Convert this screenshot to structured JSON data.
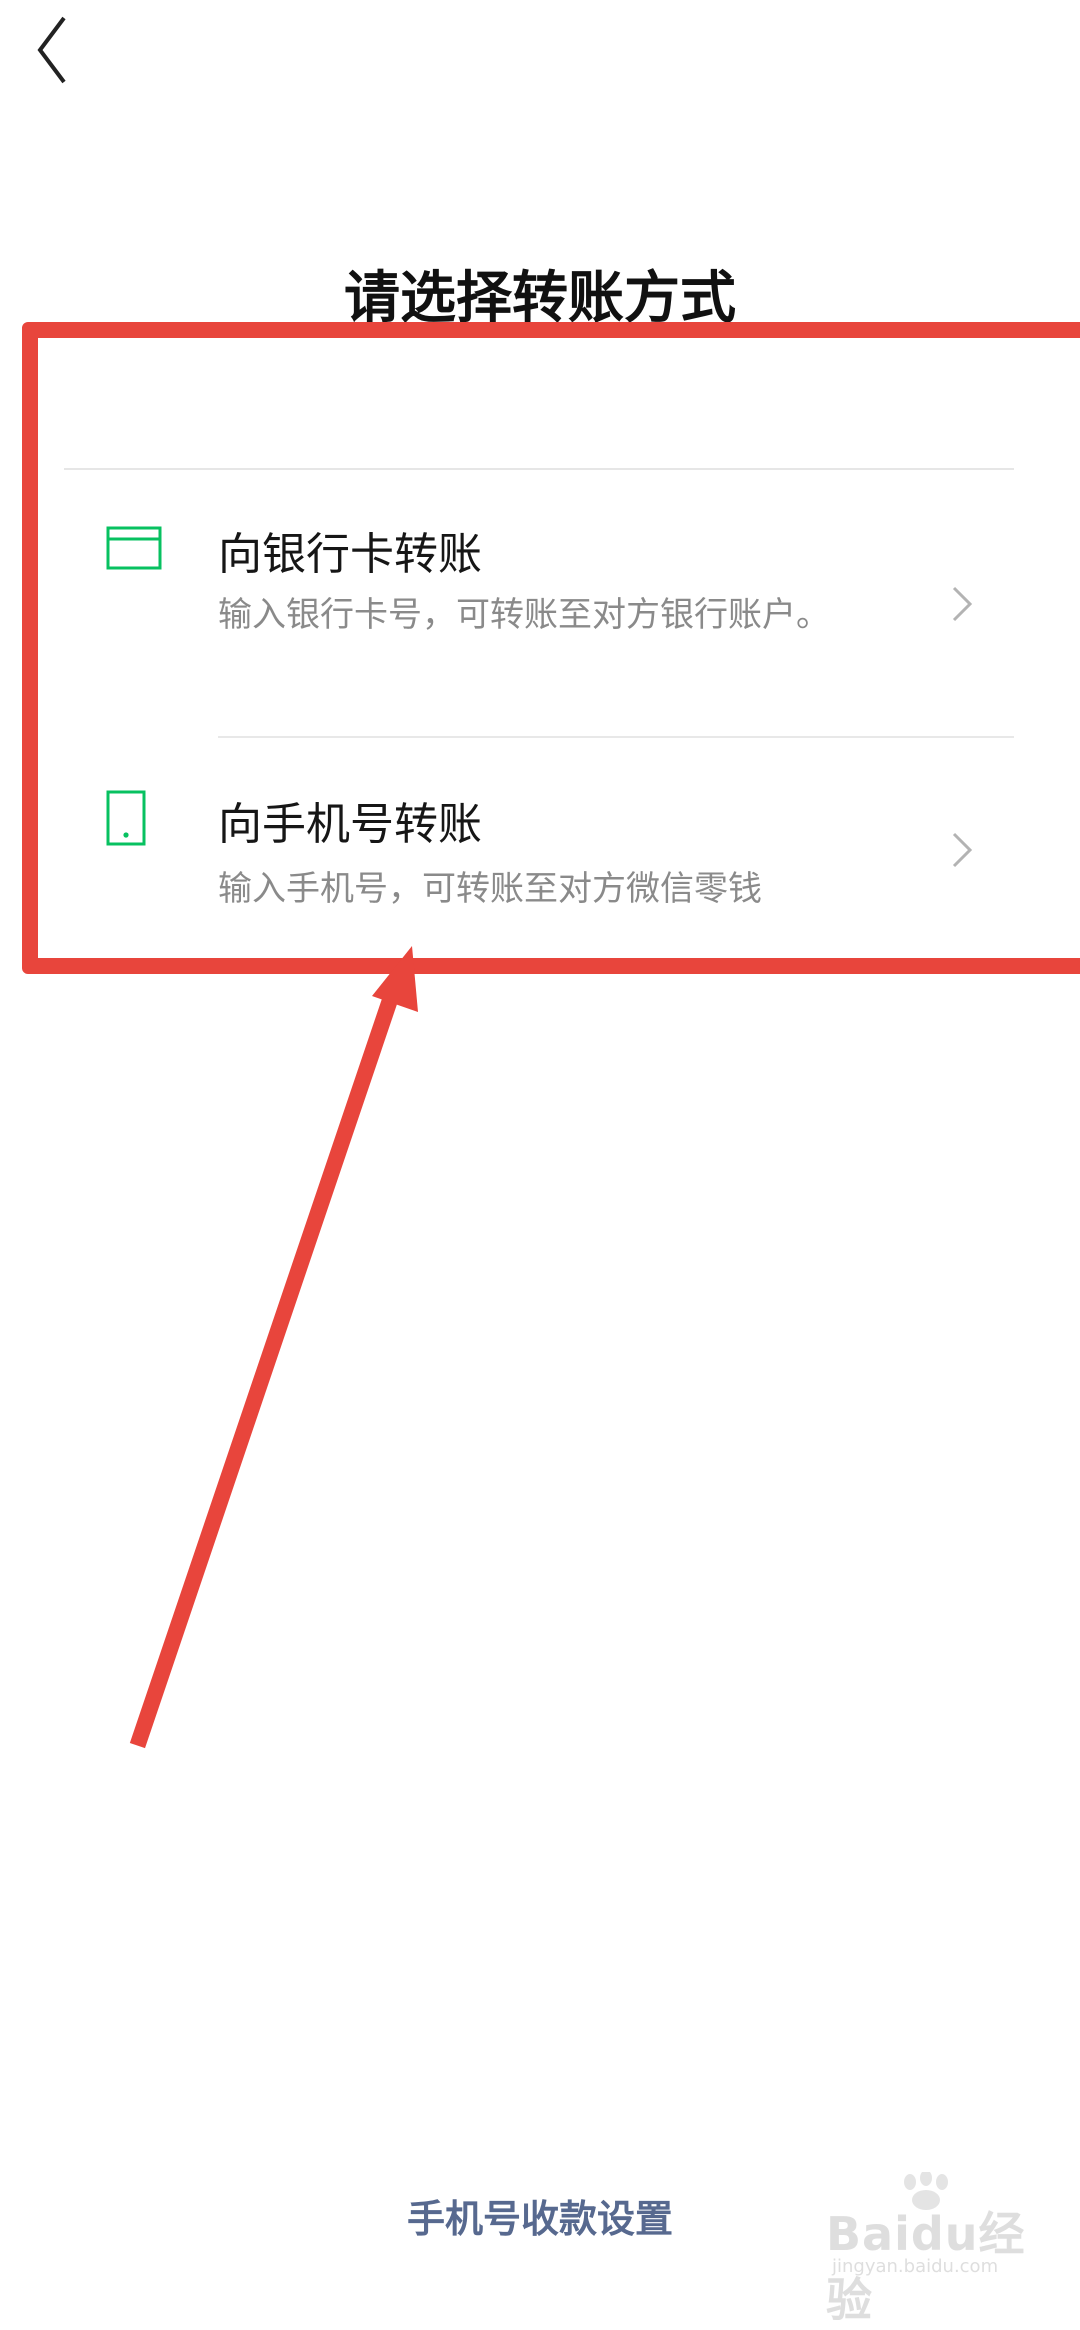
{
  "header": {
    "back_icon": "chevron-left-icon",
    "title": "请选择转账方式"
  },
  "options": [
    {
      "icon": "bank-card-icon",
      "title": "向银行卡转账",
      "description": "输入银行卡号，可转账至对方银行账户。",
      "chevron": "chevron-right-icon"
    },
    {
      "icon": "phone-icon",
      "title": "向手机号转账",
      "description": "输入手机号，可转账至对方微信零钱",
      "chevron": "chevron-right-icon"
    }
  ],
  "footer": {
    "link_label": "手机号收款设置"
  },
  "watermark": {
    "brand": "Baidu经验",
    "url": "jingyan.baidu.com"
  },
  "colors": {
    "accent_green": "#07c160",
    "annotation_red": "#e8453c",
    "link_blue": "#57698f",
    "secondary_text": "#8a8a8a"
  }
}
